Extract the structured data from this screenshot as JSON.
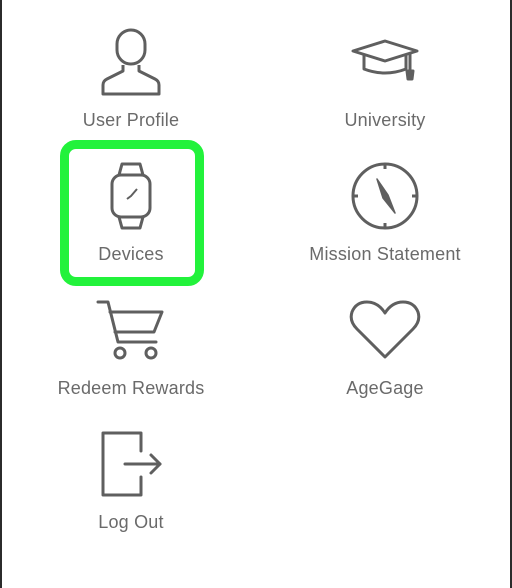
{
  "menu": {
    "items": [
      {
        "label": "User Profile",
        "icon": "user-icon"
      },
      {
        "label": "University",
        "icon": "graduation-cap-icon"
      },
      {
        "label": "Devices",
        "icon": "smartwatch-icon"
      },
      {
        "label": "Mission Statement",
        "icon": "compass-icon"
      },
      {
        "label": "Redeem Rewards",
        "icon": "shopping-cart-icon"
      },
      {
        "label": "AgeGage",
        "icon": "heart-icon"
      },
      {
        "label": "Log Out",
        "icon": "logout-icon"
      }
    ],
    "selected": "Devices"
  },
  "colors": {
    "icon": "#5f5f5f",
    "label": "#6a6a6a",
    "highlight": "#22f23b",
    "background": "#ffffff"
  }
}
